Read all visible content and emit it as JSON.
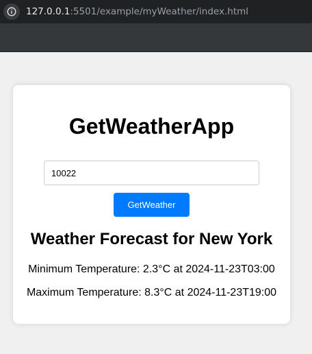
{
  "browser": {
    "url_host": "127.0.0.1",
    "url_rest": ":5501/example/myWeather/index.html",
    "site_info_icon": "info-circle-icon"
  },
  "app": {
    "title": "GetWeatherApp",
    "zip_input_value": "10022",
    "button_label": "GetWeather",
    "button_color": "#007bff"
  },
  "forecast": {
    "heading": "Weather Forecast for New York",
    "min_line": "Minimum Temperature: 2.3°C at 2024-11-23T03:00",
    "max_line": "Maximum Temperature: 8.3°C at 2024-11-23T19:00"
  },
  "colors": {
    "page_bg": "#f0f0f0",
    "card_bg": "#ffffff",
    "chrome_bg": "#2b2e31"
  }
}
